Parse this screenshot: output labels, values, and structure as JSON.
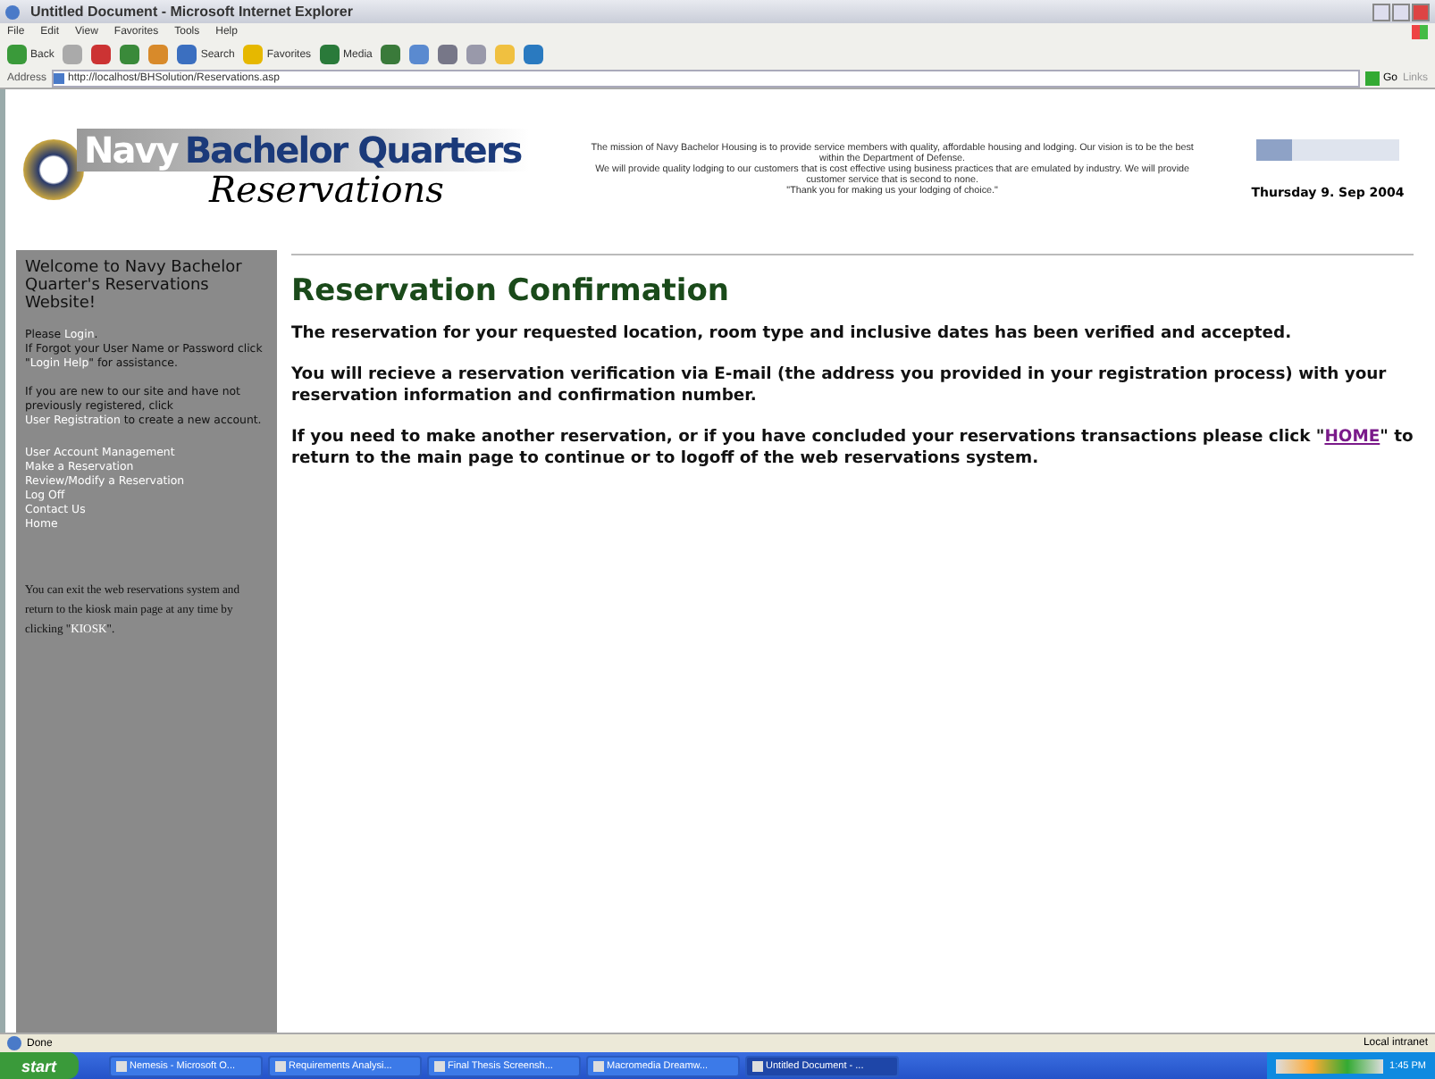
{
  "window": {
    "title": "Untitled Document - Microsoft Internet Explorer"
  },
  "menu": [
    "File",
    "Edit",
    "View",
    "Favorites",
    "Tools",
    "Help"
  ],
  "toolbar": [
    {
      "kind": "back",
      "label": "Back"
    },
    {
      "kind": "forward"
    },
    {
      "kind": "stop"
    },
    {
      "kind": "refresh"
    },
    {
      "kind": "home"
    },
    {
      "kind": "search",
      "label": "Search"
    },
    {
      "kind": "favorites",
      "label": "Favorites"
    },
    {
      "kind": "media",
      "label": "Media"
    },
    {
      "kind": "history"
    },
    {
      "kind": "mail"
    },
    {
      "kind": "print"
    },
    {
      "kind": "edit"
    },
    {
      "kind": "folder"
    },
    {
      "kind": "messenger"
    }
  ],
  "address": {
    "label": "Address",
    "value": "http://localhost/BHSolution/Reservations.asp",
    "go": "Go",
    "links": "Links"
  },
  "header": {
    "logo_word1": "Navy",
    "logo_word2": "Bachelor Quarters",
    "logo_script": "Reservations",
    "mission": [
      "The mission of Navy Bachelor Housing is to provide service members with quality, affordable housing and lodging. Our vision is to be the best within the Department of Defense.",
      "We will provide quality lodging to our customers that is cost effective using business practices that are emulated by industry. We will provide customer service that is second to none.",
      "\"Thank you for making us your lodging of choice.\""
    ],
    "date": "Thursday 9. Sep 2004"
  },
  "sidebar": {
    "welcome": "Welcome to Navy Bachelor Quarter's Reservations Website!",
    "paragraphs": [
      [
        {
          "kind": "text",
          "text": "Please "
        },
        {
          "kind": "link",
          "text": "Login"
        },
        {
          "kind": "text",
          "text": "."
        },
        {
          "kind": "break"
        },
        {
          "kind": "text",
          "text": "If Forgot your User Name or Password click \""
        },
        {
          "kind": "link",
          "text": "Login Help"
        },
        {
          "kind": "text",
          "text": "\" for assistance."
        }
      ],
      [
        {
          "kind": "text",
          "text": "If you are new to our site and have not previously registered, click "
        },
        {
          "kind": "link",
          "text": "User Registration"
        },
        {
          "kind": "text",
          "text": " to create a new account."
        }
      ]
    ],
    "links": [
      "User Account Management",
      "Make a Reservation",
      "Review/Modify a Reservation",
      "Log Off",
      "Contact Us",
      "Home"
    ],
    "kiosk_note": [
      {
        "kind": "text",
        "text": "You can exit the web reservations system and return to the kiosk main page at any time by clicking \""
      },
      {
        "kind": "link",
        "text": "KIOSK"
      },
      {
        "kind": "text",
        "text": "\"."
      }
    ]
  },
  "content": {
    "heading": "Reservation Confirmation",
    "paragraphs": [
      [
        {
          "kind": "text",
          "text": "The reservation for your requested location, room type and inclusive dates has been verified and accepted."
        }
      ],
      [
        {
          "kind": "text",
          "text": "You will recieve a reservation verification via E-mail (the address you provided in your registration process) with your reservation information and confirmation number."
        }
      ],
      [
        {
          "kind": "text",
          "text": "If you need to make another reservation, or if you have concluded your reservations transactions please click \""
        },
        {
          "kind": "link",
          "text": "HOME"
        },
        {
          "kind": "text",
          "text": "\" to return to the main page to continue or to logoff of the web reservations system."
        }
      ]
    ]
  },
  "status_bar": {
    "text": "Done",
    "zone": "Local intranet"
  },
  "taskbar": {
    "start": "start",
    "items": [
      {
        "label": "Nemesis - Microsoft O...",
        "selected": false
      },
      {
        "label": "Requirements Analysi...",
        "selected": false
      },
      {
        "label": "Final Thesis Screensh...",
        "selected": false
      },
      {
        "label": "Macromedia Dreamw...",
        "selected": false
      },
      {
        "label": "Untitled Document - ...",
        "selected": true
      }
    ],
    "clock": "1:45 PM"
  }
}
